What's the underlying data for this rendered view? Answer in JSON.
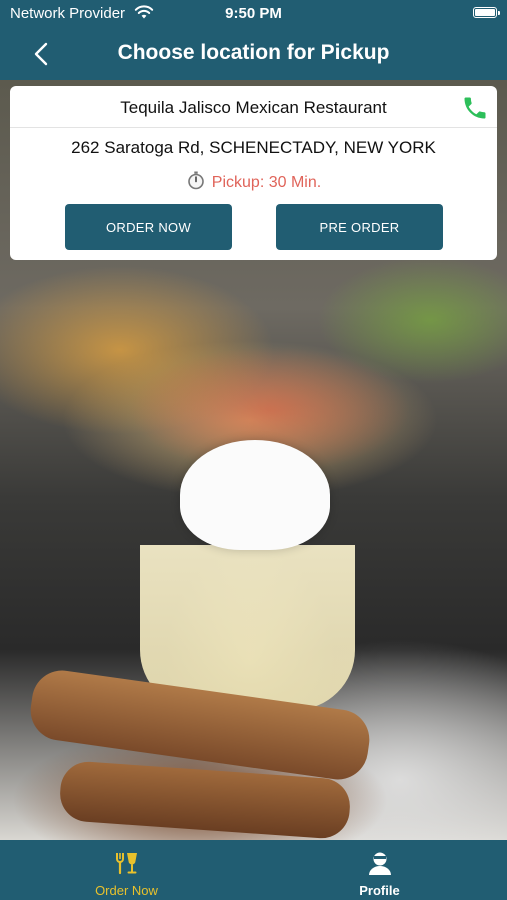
{
  "status_bar": {
    "carrier": "Network Provider",
    "time": "9:50 PM"
  },
  "nav": {
    "title": "Choose location for Pickup"
  },
  "restaurant": {
    "name": "Tequila Jalisco Mexican Restaurant",
    "address": "262 Saratoga Rd, SCHENECTADY, NEW YORK",
    "pickup_text": "Pickup: 30 Min.",
    "order_now_label": "ORDER NOW",
    "pre_order_label": "PRE ORDER"
  },
  "tabs": [
    {
      "label": "Order Now",
      "icon": "fork-glass-icon",
      "active": true
    },
    {
      "label": "Profile",
      "icon": "user-icon",
      "active": false
    }
  ],
  "colors": {
    "primary": "#215d72",
    "accent_active_tab": "#e9c12c",
    "pickup_text": "#e0645a",
    "phone_icon": "#2dbf5a"
  }
}
